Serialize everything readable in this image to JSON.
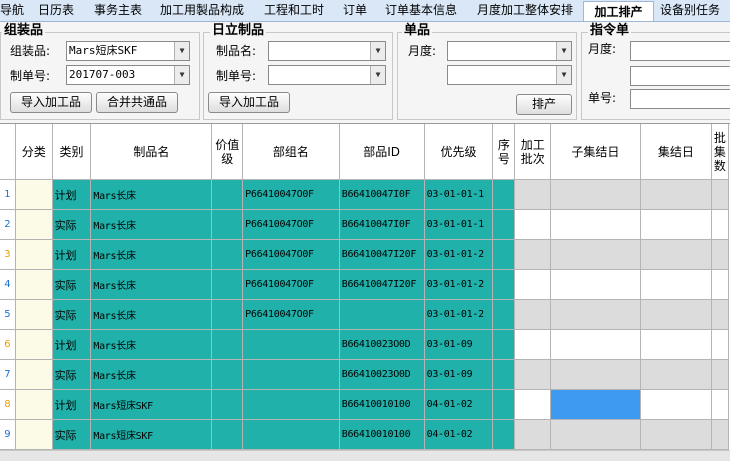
{
  "tabs": [
    {
      "label": "导航"
    },
    {
      "label": "日历表"
    },
    {
      "label": "事务主表"
    },
    {
      "label": "加工用製品构成"
    },
    {
      "label": "工程和工时"
    },
    {
      "label": "订单"
    },
    {
      "label": "订单基本信息"
    },
    {
      "label": "月度加工整体安排"
    },
    {
      "label": "加工排产",
      "active": true
    },
    {
      "label": "设备别任务"
    }
  ],
  "assembly": {
    "title": "组装品",
    "product_label": "组装品:",
    "product_value": "Mars短床SKF",
    "order_label": "制单号:",
    "order_value": "201707-003",
    "import_btn": "导入加工品",
    "merge_btn": "合并共通品"
  },
  "hitachi": {
    "title": "日立制品",
    "name_label": "制品名:",
    "order_label": "制单号:",
    "import_btn": "导入加工品"
  },
  "single": {
    "title": "单品",
    "month_label": "月度:",
    "schedule_btn": "排产"
  },
  "instruction": {
    "title": "指令单",
    "month_label": "月度:",
    "order_label": "单号:"
  },
  "grid": {
    "headers": [
      "",
      "分类",
      "类别",
      "制品名",
      "价值级",
      "部组名",
      "部品ID",
      "优先级",
      "序号",
      "加工批次",
      "子集结日",
      "集结日",
      "批集数"
    ],
    "rows": [
      {
        "no": "1",
        "type": "计划",
        "name": "Mars长床",
        "part_group": "P66410047O0F",
        "part_id": "B66410047I0F",
        "priority": "03-01-01-1"
      },
      {
        "no": "2",
        "type": "实际",
        "name": "Mars长床",
        "part_group": "P66410047O0F",
        "part_id": "B66410047I0F",
        "priority": "03-01-01-1"
      },
      {
        "no": "3",
        "type": "计划",
        "name": "Mars长床",
        "part_group": "P66410047O0F",
        "part_id": "B66410047I20F",
        "priority": "03-01-01-2"
      },
      {
        "no": "4",
        "type": "实际",
        "name": "Mars长床",
        "part_group": "P66410047O0F",
        "part_id": "B66410047I20F",
        "priority": "03-01-01-2"
      },
      {
        "no": "5",
        "type": "实际",
        "name": "Mars长床",
        "part_group": "P66410047O0F",
        "part_id": "",
        "priority": "03-01-01-2"
      },
      {
        "no": "6",
        "type": "计划",
        "name": "Mars长床",
        "part_group": "",
        "part_id": "B66410023O0D",
        "priority": "03-01-09"
      },
      {
        "no": "7",
        "type": "实际",
        "name": "Mars长床",
        "part_group": "",
        "part_id": "B66410023O0D",
        "priority": "03-01-09"
      },
      {
        "no": "8",
        "type": "计划",
        "name": "Mars短床SKF",
        "part_group": "",
        "part_id": "B66410010100",
        "priority": "04-01-02"
      },
      {
        "no": "9",
        "type": "实际",
        "name": "Mars短床SKF",
        "part_group": "",
        "part_id": "B66410010100",
        "priority": "04-01-02"
      }
    ]
  }
}
